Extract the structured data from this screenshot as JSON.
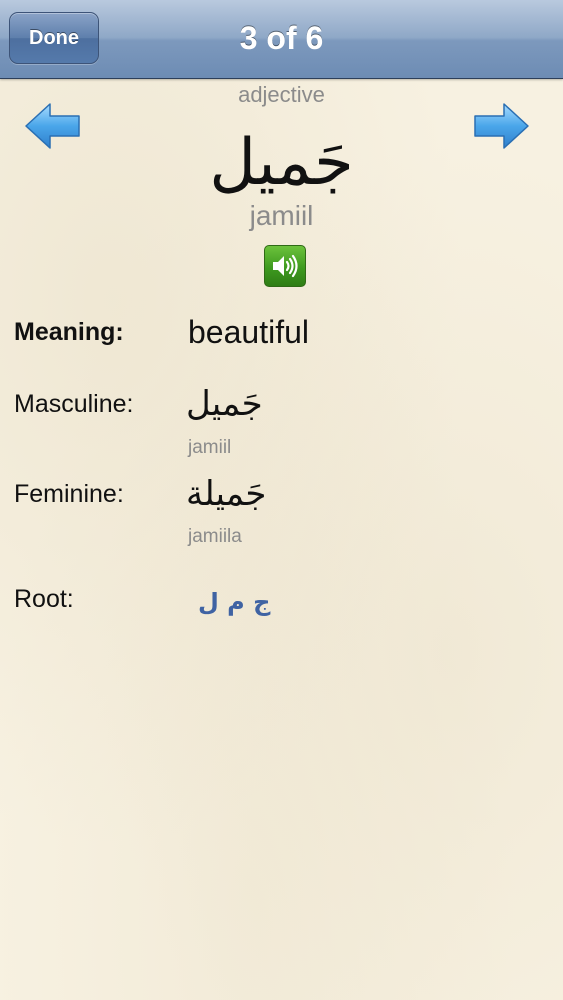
{
  "navbar": {
    "done_label": "Done",
    "title": "3 of 6"
  },
  "word": {
    "part_of_speech": "adjective",
    "arabic": "جَميل",
    "transliteration": "jamiil",
    "audio_icon": "speaker-icon"
  },
  "details": {
    "meaning_label": "Meaning:",
    "meaning_value": "beautiful",
    "masculine_label": "Masculine:",
    "masculine_arabic": "جَميل",
    "masculine_translit": "jamiil",
    "feminine_label": "Feminine:",
    "feminine_arabic": "جَميلة",
    "feminine_translit": "jamiila",
    "root_label": "Root:",
    "root_value": "ج م ل"
  },
  "colors": {
    "navbar_blue": "#7d99bd",
    "arrow_blue": "#4a9fe0",
    "speaker_green": "#3e9a1f",
    "root_blue": "#3f63a3",
    "background": "#f7f1e1"
  }
}
